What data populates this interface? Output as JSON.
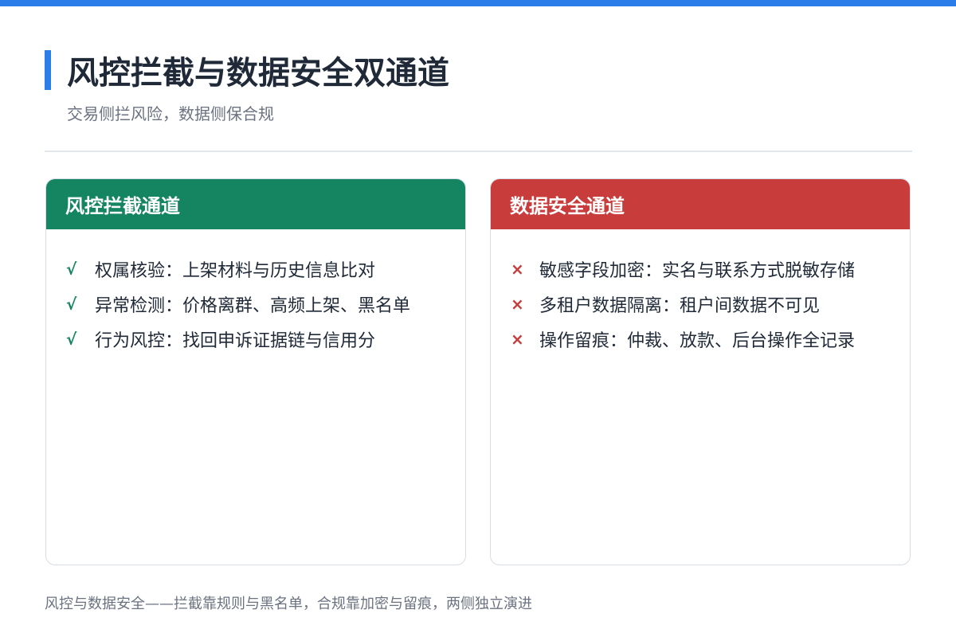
{
  "header": {
    "title": "风控拦截与数据安全双通道",
    "subtitle": "交易侧拦风险，数据侧保合规"
  },
  "colors": {
    "accent": "#2b7de9",
    "risk_header": "#148560",
    "data_header": "#c93c3c",
    "check_mark": "#148560",
    "cross_mark": "#c93c3c"
  },
  "risk_channel": {
    "title": "风控拦截通道",
    "marker": "√",
    "items": [
      "权属核验：上架材料与历史信息比对",
      "异常检测：价格离群、高频上架、黑名单",
      "行为风控：找回申诉证据链与信用分"
    ]
  },
  "data_channel": {
    "title": "数据安全通道",
    "marker": "×",
    "items": [
      "敏感字段加密：实名与联系方式脱敏存储",
      "多租户数据隔离：租户间数据不可见",
      "操作留痕：仲裁、放款、后台操作全记录"
    ]
  },
  "footer": {
    "note": "风控与数据安全——拦截靠规则与黑名单，合规靠加密与留痕，两侧独立演进"
  }
}
